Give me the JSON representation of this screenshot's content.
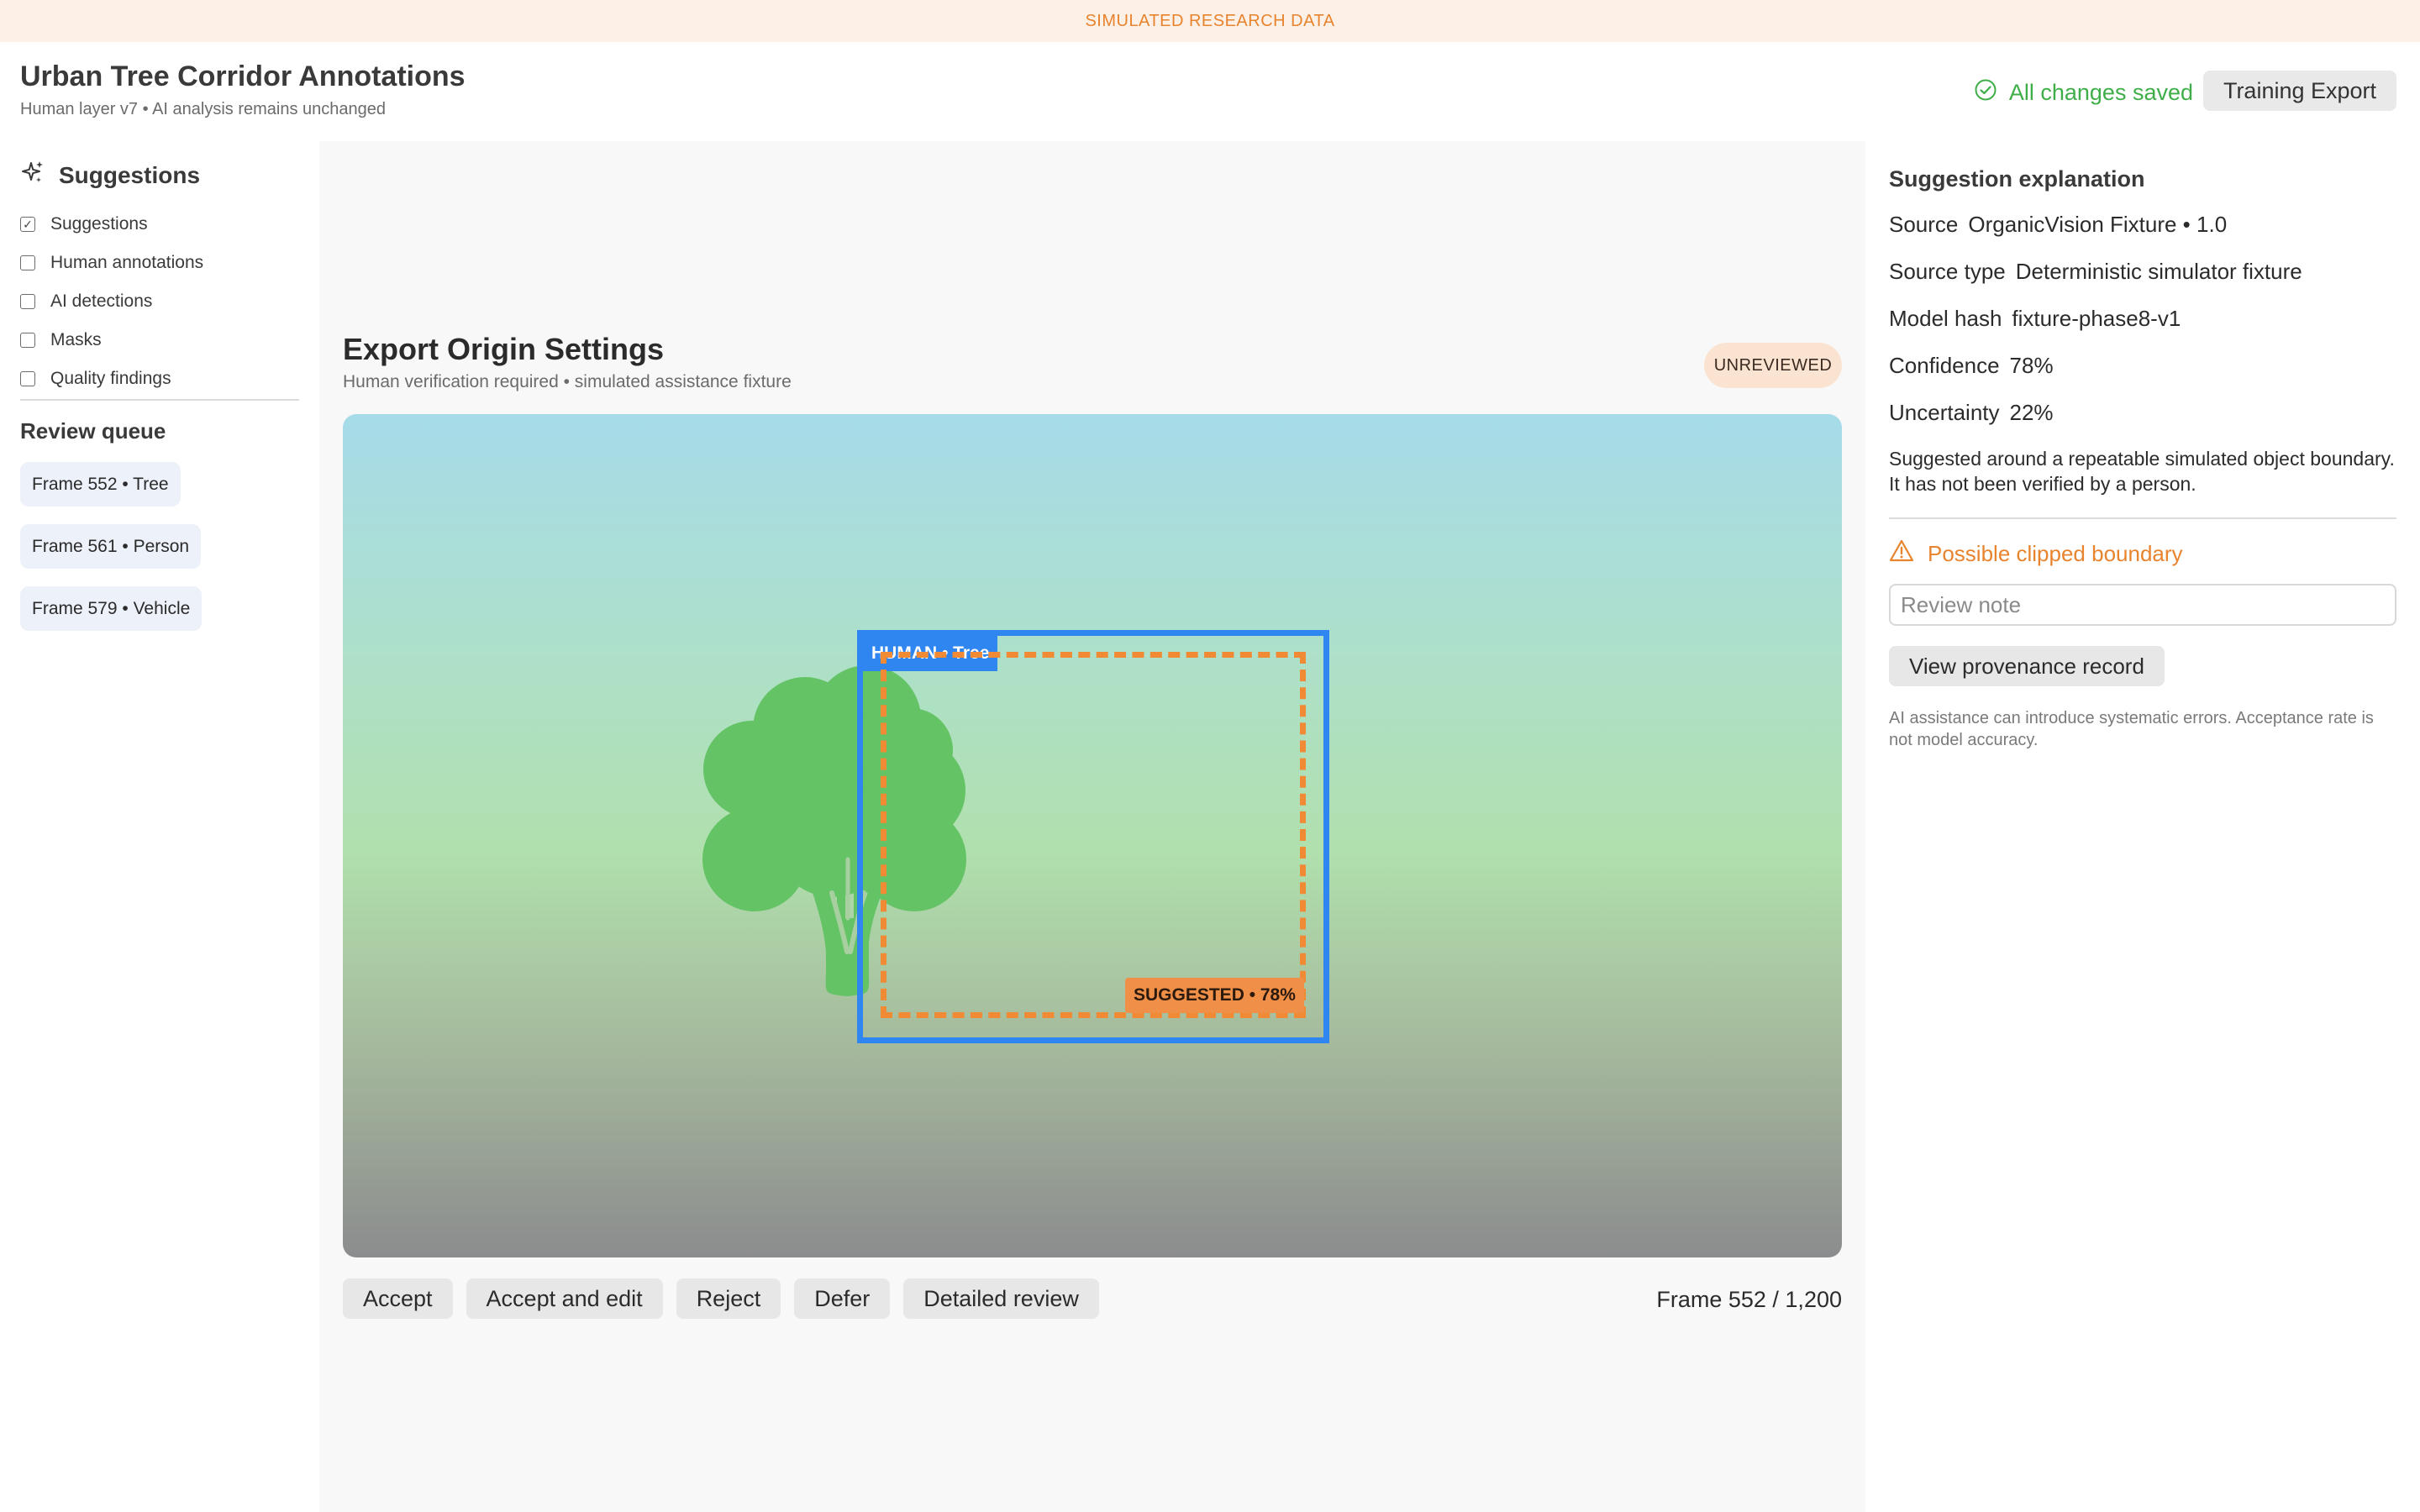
{
  "banner": {
    "text": "SIMULATED RESEARCH DATA"
  },
  "header": {
    "title": "Urban Tree Corridor Annotations",
    "subtitle": "Human layer v7 • AI analysis remains unchanged",
    "save_status": "All changes saved",
    "export_label": "Training Export"
  },
  "sidebar": {
    "heading": "Suggestions",
    "layers": [
      {
        "label": "Suggestions",
        "checked": true
      },
      {
        "label": "Human annotations",
        "checked": false
      },
      {
        "label": "AI detections",
        "checked": false
      },
      {
        "label": "Masks",
        "checked": false
      },
      {
        "label": "Quality findings",
        "checked": false
      }
    ],
    "queue_title": "Review queue",
    "queue": [
      {
        "label": "Frame 552 • Tree"
      },
      {
        "label": "Frame 561 • Person"
      },
      {
        "label": "Frame 579 • Vehicle"
      }
    ]
  },
  "main": {
    "title": "Export Origin Settings",
    "subtitle": "Human verification required • simulated assistance fixture",
    "status_badge": "UNREVIEWED",
    "human_label": "HUMAN • Tree",
    "suggested_label": "SUGGESTED • 78%",
    "actions": [
      "Accept",
      "Accept and edit",
      "Reject",
      "Defer",
      "Detailed review"
    ],
    "frame_counter": "Frame 552 / 1,200"
  },
  "explanation": {
    "title": "Suggestion explanation",
    "fields": [
      {
        "key": "Source",
        "value": "OrganicVision Fixture • 1.0"
      },
      {
        "key": "Source type",
        "value": "Deterministic simulator fixture"
      },
      {
        "key": "Model hash",
        "value": "fixture-phase8-v1"
      },
      {
        "key": "Confidence",
        "value": "78%"
      },
      {
        "key": "Uncertainty",
        "value": "22%"
      }
    ],
    "description": "Suggested around a repeatable simulated object boundary. It has not been verified by a person.",
    "warning": "Possible clipped boundary",
    "note_placeholder": "Review note",
    "provenance_label": "View provenance record",
    "disclaimer": "AI assistance can introduce systematic errors. Acceptance rate is not model accuracy."
  },
  "colors": {
    "accent_orange": "#e8832e",
    "human_blue": "#2f86f0",
    "ai_orange": "#f08a34",
    "saved_green": "#3fae49",
    "tree_green": "#63c365"
  },
  "icons": {
    "save": "check-circle-icon",
    "suggestions": "sparkle-icon",
    "warning": "warning-triangle-icon"
  }
}
